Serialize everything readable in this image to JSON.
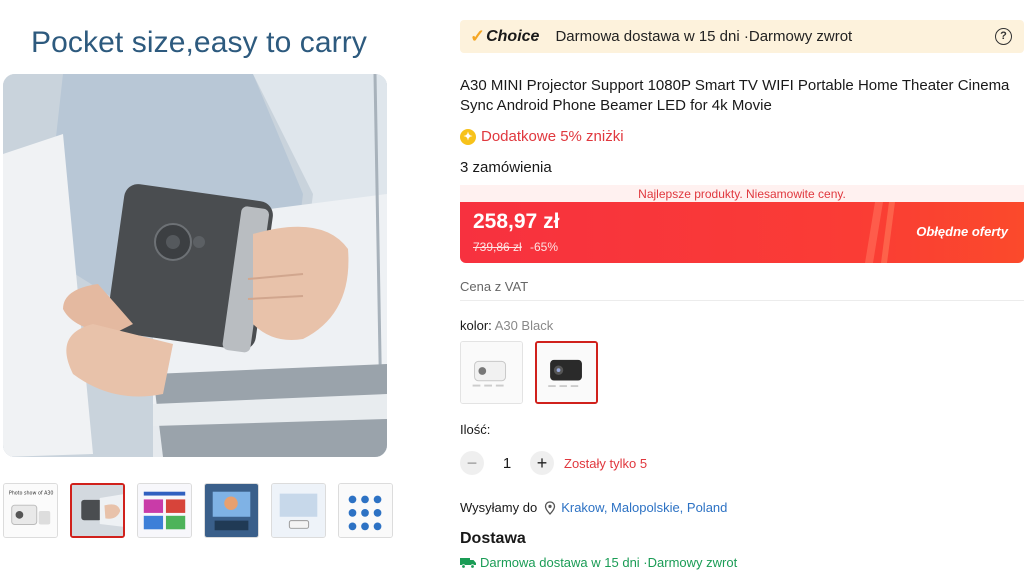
{
  "gallery": {
    "hero_caption": "Pocket size,easy to carry",
    "thumbnails": [
      {
        "caption": "Photo show of A30"
      },
      {
        "caption": ""
      },
      {
        "caption": ""
      },
      {
        "caption": ""
      },
      {
        "caption": ""
      },
      {
        "caption": ""
      }
    ],
    "active_thumbnail": 1
  },
  "choice_bar": {
    "logo": "Choice",
    "text": "Darmowa dostawa w 15 dni ·Darmowy zwrot",
    "help_icon": "question-circle-icon"
  },
  "product": {
    "title": "A30 MINI Projector Support 1080P Smart TV WIFI Portable Home Theater Cinema Sync Android Phone Beamer LED for 4k Movie",
    "extra_discount": "Dodatkowe 5% zniżki",
    "orders": "3 zamówienia"
  },
  "price": {
    "promo_strip": "Najlepsze produkty. Niesamowite ceny.",
    "current": "258,97 zł",
    "original": "739,86 zł",
    "discount": "-65%",
    "deal_label": "Obłędne oferty",
    "vat_note": "Cena z VAT",
    "colors": {
      "bg": "#f7313f",
      "accent": "#e0383e"
    }
  },
  "variant": {
    "label": "kolor: ",
    "value": "A30 Black",
    "options": [
      "white",
      "black"
    ],
    "selected": 1
  },
  "quantity": {
    "label": "Ilość:",
    "minus": "−",
    "value": "1",
    "plus": "+",
    "stock": "Zostały tylko 5"
  },
  "shipping": {
    "label": "Wysyłamy do",
    "location": "Krakow, Malopolskie, Poland",
    "delivery_title": "Dostawa",
    "delivery_line": "Darmowa dostawa w 15 dni ·Darmowy zwrot"
  }
}
